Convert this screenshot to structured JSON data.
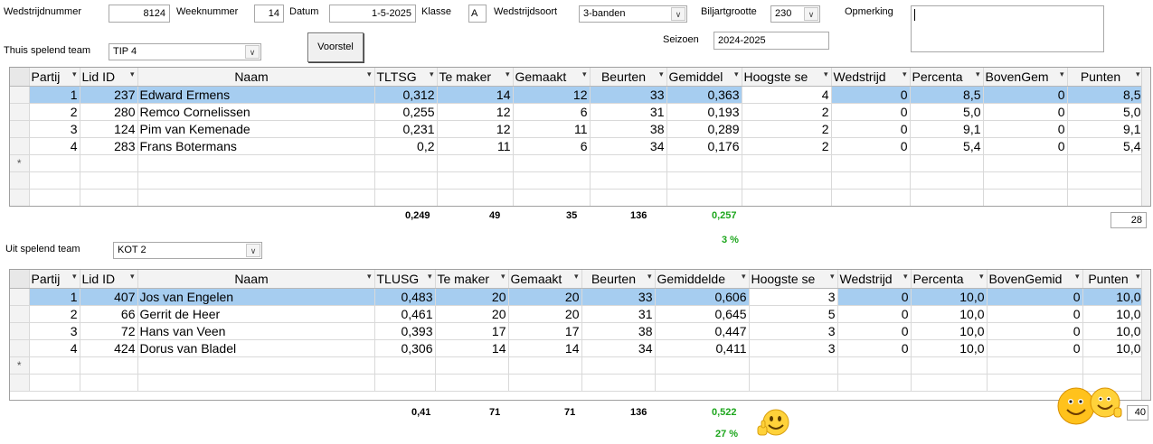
{
  "form": {
    "wedstrijdnummer_label": "Wedstrijdnummer",
    "wedstrijdnummer": "8124",
    "weeknummer_label": "Weeknummer",
    "weeknummer": "14",
    "datum_label": "Datum",
    "datum": "1-5-2025",
    "klasse_label": "Klasse",
    "klasse": "A",
    "wedstrijdsoort_label": "Wedstrijdsoort",
    "wedstrijdsoort": "3-banden",
    "biljartgrootte_label": "Biljartgrootte",
    "biljartgrootte": "230",
    "opmerking_label": "Opmerking",
    "opmerking": "",
    "thuis_label": "Thuis spelend team",
    "thuis_team": "TIP 4",
    "voorstel_button": "Voorstel",
    "seizoen_label": "Seizoen",
    "seizoen": "2024-2025",
    "uit_label": "Uit spelend team",
    "uit_team": "KOT 2"
  },
  "home_grid": {
    "columns": [
      "Partij",
      "Lid ID",
      "Naam",
      "TLTSG",
      "Te maker",
      "Gemaakt",
      "Beurten",
      "Gemiddel",
      "Hoogste se",
      "Wedstrijd",
      "Percenta",
      "BovenGem",
      "Punten"
    ],
    "rows": [
      [
        "1",
        "237",
        "Edward Ermens",
        "0,312",
        "14",
        "12",
        "33",
        "0,363",
        "4",
        "0",
        "8,5",
        "0",
        "8,5"
      ],
      [
        "2",
        "280",
        "Remco Cornelissen",
        "0,255",
        "12",
        "6",
        "31",
        "0,193",
        "2",
        "0",
        "5,0",
        "0",
        "5,0"
      ],
      [
        "3",
        "124",
        "Pim van Kemenade",
        "0,231",
        "12",
        "11",
        "38",
        "0,289",
        "2",
        "0",
        "9,1",
        "0",
        "9,1"
      ],
      [
        "4",
        "283",
        "Frans Botermans",
        "0,2",
        "11",
        "6",
        "34",
        "0,176",
        "2",
        "0",
        "5,4",
        "0",
        "5,4"
      ]
    ],
    "new_row_marker": "*",
    "totals": {
      "tltsg": "0,249",
      "te_maken": "49",
      "gemaakt": "35",
      "beurten": "136",
      "gemiddelde": "0,257",
      "percent": "3 %"
    },
    "punten_total": "28"
  },
  "away_grid": {
    "columns": [
      "Partij",
      "Lid ID",
      "Naam",
      "TLUSG",
      "Te maker",
      "Gemaakt",
      "Beurten",
      "Gemiddelde",
      "Hoogste se",
      "Wedstrijd",
      "Percenta",
      "BovenGemid",
      "Punten"
    ],
    "rows": [
      [
        "1",
        "407",
        "Jos van Engelen",
        "0,483",
        "20",
        "20",
        "33",
        "0,606",
        "3",
        "0",
        "10,0",
        "0",
        "10,0"
      ],
      [
        "2",
        "66",
        "Gerrit de Heer",
        "0,461",
        "20",
        "20",
        "31",
        "0,645",
        "5",
        "0",
        "10,0",
        "0",
        "10,0"
      ],
      [
        "3",
        "72",
        "Hans van Veen",
        "0,393",
        "17",
        "17",
        "38",
        "0,447",
        "3",
        "0",
        "10,0",
        "0",
        "10,0"
      ],
      [
        "4",
        "424",
        "Dorus van Bladel",
        "0,306",
        "14",
        "14",
        "34",
        "0,411",
        "3",
        "0",
        "10,0",
        "0",
        "10,0"
      ]
    ],
    "new_row_marker": "*",
    "totals": {
      "tlusg": "0,41",
      "te_maken": "71",
      "gemaakt": "71",
      "beurten": "136",
      "gemiddelde": "0,522",
      "percent": "27 %"
    },
    "punten_total": "40"
  },
  "icons": {
    "winner": "two-smileys-icon",
    "thumbs": "thumbs-up-smiley-icon"
  },
  "colors": {
    "selected_row": "#a6cdf0",
    "green_text": "#1da61d"
  }
}
